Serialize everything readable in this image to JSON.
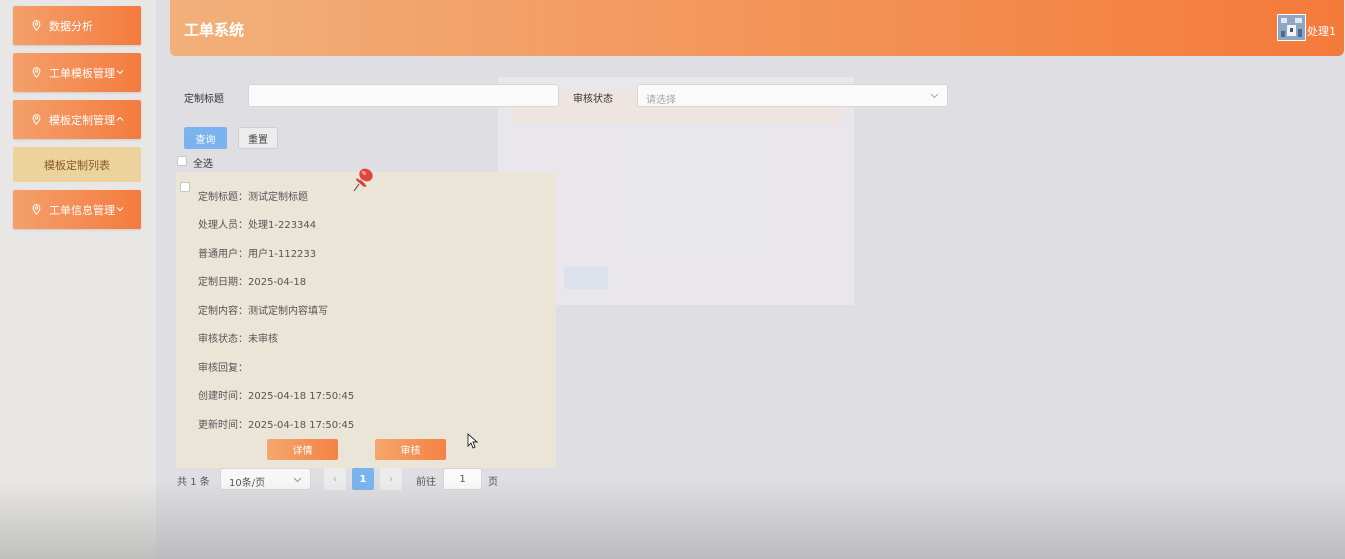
{
  "app": {
    "title": "工单系统",
    "user": "处理1"
  },
  "sidebar": {
    "items": [
      {
        "label": "数据分析",
        "icon": "location-pin-icon"
      },
      {
        "label": "工单模板管理",
        "icon": "location-pin-icon",
        "arrow": "chevron-down-icon"
      },
      {
        "label": "模板定制管理",
        "icon": "location-pin-icon",
        "arrow": "chevron-up-icon"
      },
      {
        "label": "工单信息管理",
        "icon": "location-pin-icon",
        "arrow": "chevron-down-icon"
      }
    ],
    "sub_item": "模板定制列表"
  },
  "filters": {
    "title_label": "定制标题",
    "title_value": "",
    "status_label": "审核状态",
    "status_placeholder": "请选择",
    "query_button": "查询",
    "reset_button": "重置",
    "select_all": "全选"
  },
  "card": {
    "fields": [
      {
        "label": "定制标题：",
        "value": "测试定制标题"
      },
      {
        "label": "处理人员：",
        "value": "处理1-223344"
      },
      {
        "label": "普通用户：",
        "value": "用户1-112233"
      },
      {
        "label": "定制日期：",
        "value": "2025-04-18"
      },
      {
        "label": "定制内容：",
        "value": "测试定制内容填写"
      },
      {
        "label": "审核状态：",
        "value": "未审核"
      },
      {
        "label": "审核回复：",
        "value": ""
      },
      {
        "label": "创建时间：",
        "value": "2025-04-18 17:50:45"
      },
      {
        "label": "更新时间：",
        "value": "2025-04-18 17:50:45"
      }
    ],
    "detail_button": "详情",
    "review_button": "审核"
  },
  "pagination": {
    "total_prefix": "共",
    "total": "1",
    "total_suffix": "条",
    "page_size": "10条/页",
    "prev": "‹",
    "current": "1",
    "next": "›",
    "goto_label": "前往",
    "goto_value": "1",
    "goto_suffix": "页"
  },
  "colors": {
    "accent_orange": "#f47b3e",
    "accent_blue": "#78b4ee",
    "submenu_bg": "#ecd29d",
    "card_bg": "#ebe5d8"
  }
}
